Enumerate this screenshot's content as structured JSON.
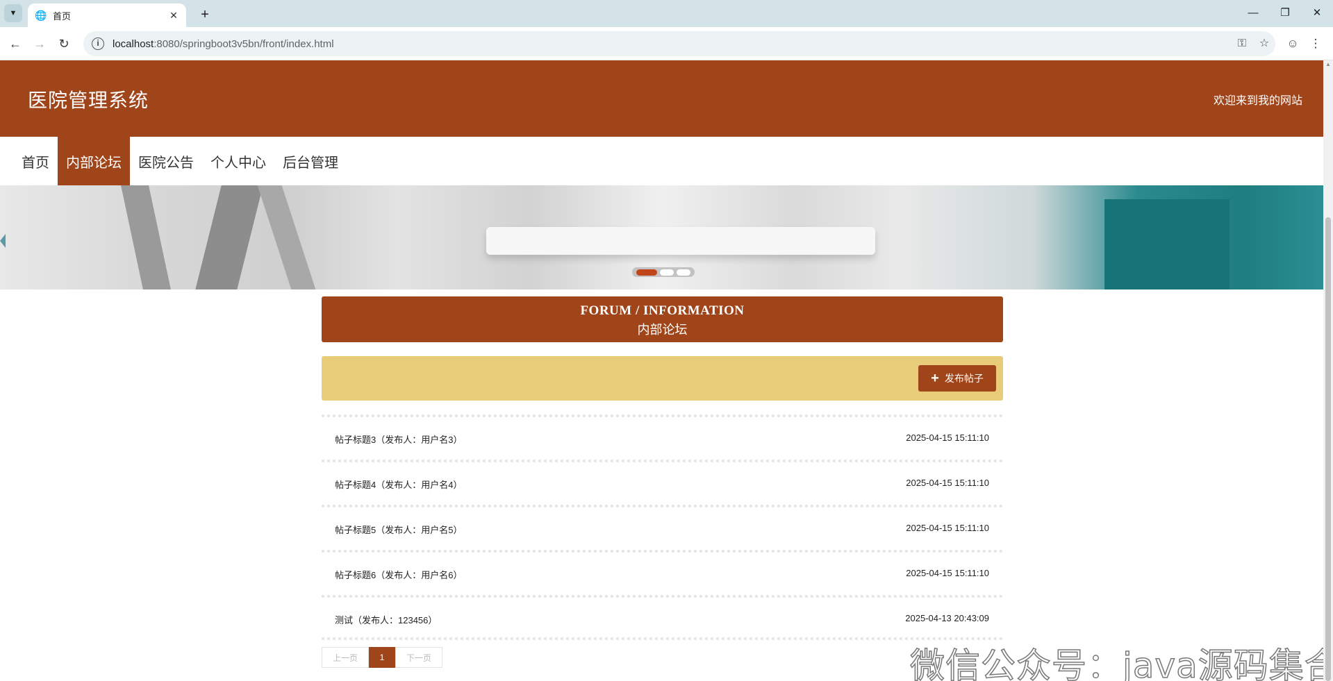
{
  "browser": {
    "tab_title": "首页",
    "url_host": "localhost",
    "url_rest": ":8080/springboot3v5bn/front/index.html"
  },
  "header": {
    "site_title": "医院管理系统",
    "welcome": "欢迎来到我的网站"
  },
  "nav": {
    "items": [
      {
        "label": "首页",
        "active": false
      },
      {
        "label": "内部论坛",
        "active": true
      },
      {
        "label": "医院公告",
        "active": false
      },
      {
        "label": "个人中心",
        "active": false
      },
      {
        "label": "后台管理",
        "active": false
      }
    ]
  },
  "banner": {
    "dots": 3,
    "active_dot": 0
  },
  "forum": {
    "title_en": "FORUM / INFORMATION",
    "title_zh": "内部论坛",
    "post_button": "发布帖子",
    "posts": [
      {
        "title": "帖子标题3（发布人：用户名3）",
        "time": "2025-04-15 15:11:10"
      },
      {
        "title": "帖子标题4（发布人：用户名4）",
        "time": "2025-04-15 15:11:10"
      },
      {
        "title": "帖子标题5（发布人：用户名5）",
        "time": "2025-04-15 15:11:10"
      },
      {
        "title": "帖子标题6（发布人：用户名6）",
        "time": "2025-04-15 15:11:10"
      },
      {
        "title": "测试（发布人：123456）",
        "time": "2025-04-13 20:43:09"
      }
    ]
  },
  "pager": {
    "prev": "上一页",
    "current": "1",
    "next": "下一页"
  },
  "watermark": "微信公众号：java源码集合",
  "colors": {
    "brand": "#a0441a",
    "action_bar": "#e8cc7a"
  }
}
